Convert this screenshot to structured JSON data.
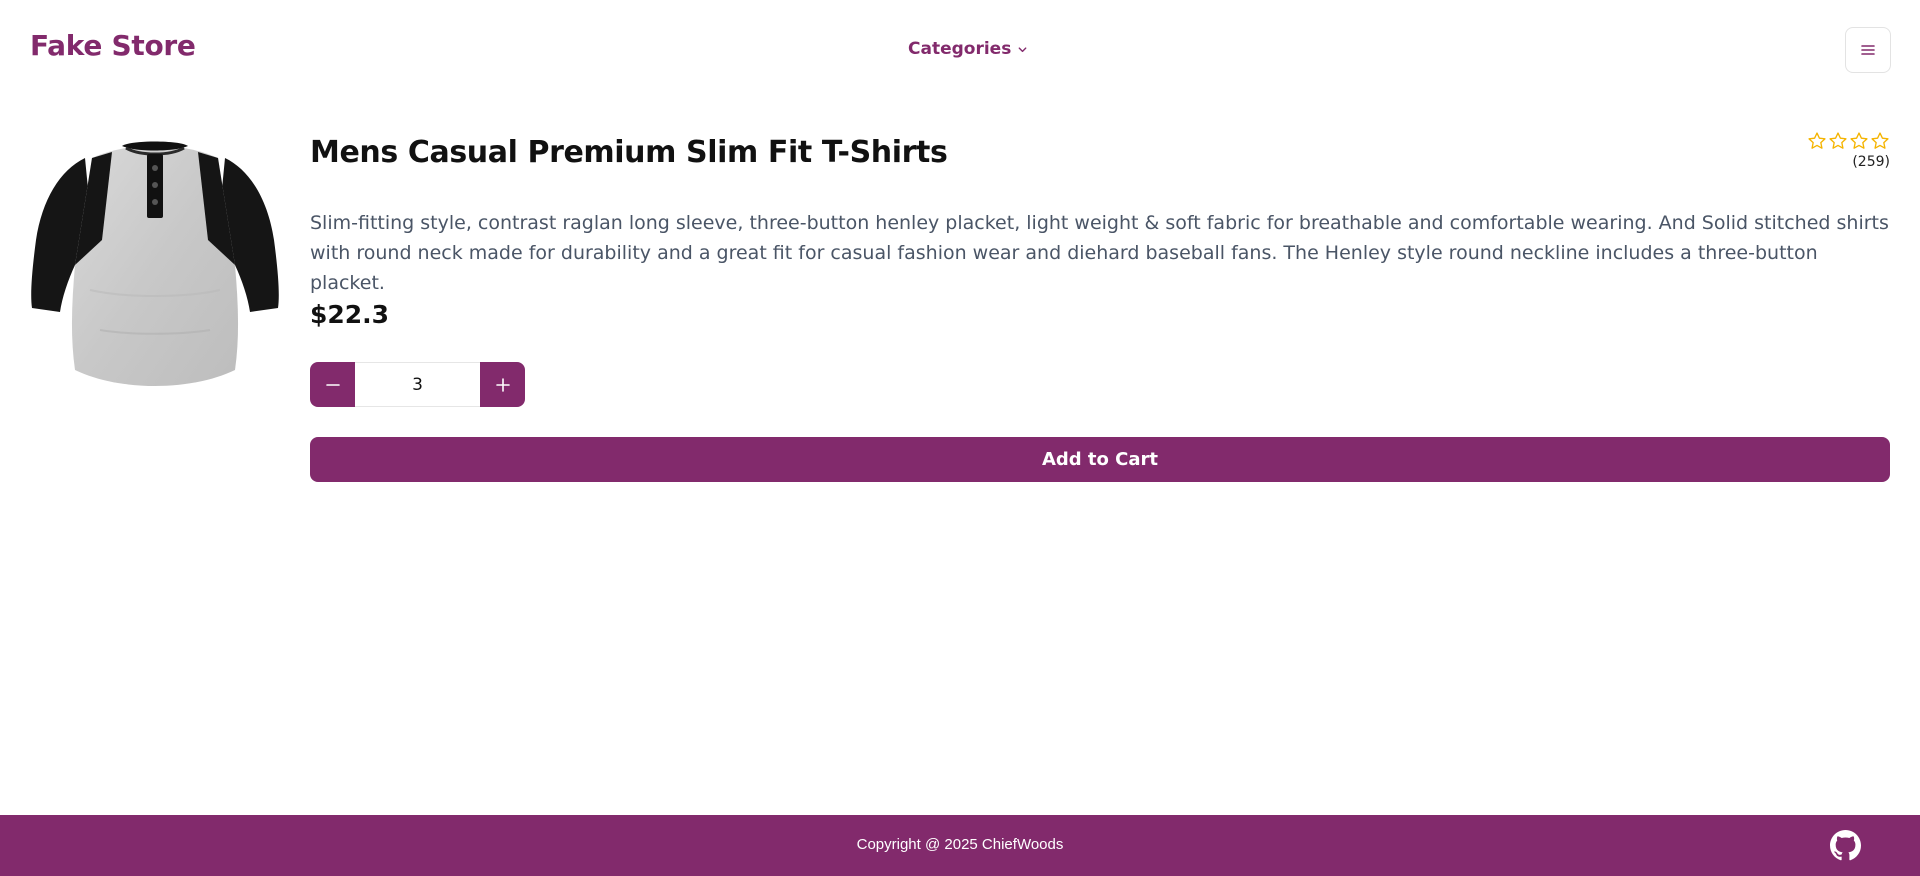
{
  "header": {
    "brand": "Fake Store",
    "categories_label": "Categories",
    "categories_icon": "chevron-down-icon",
    "menu_icon": "hamburger-menu-icon"
  },
  "product": {
    "image_icon": "t-shirt-product-image",
    "title": "Mens Casual Premium Slim Fit T-Shirts",
    "rating": {
      "stars_filled": 0,
      "stars_total": 4,
      "count": "(259)"
    },
    "description": "Slim-fitting style, contrast raglan long sleeve, three-button henley placket, light weight & soft fabric for breathable and comfortable wearing. And Solid stitched shirts with round neck made for durability and a great fit for casual fashion wear and diehard baseball fans. The Henley style round neckline includes a three-button placket.",
    "price": "$22.3",
    "quantity": "3",
    "add_to_cart_label": "Add to Cart"
  },
  "footer": {
    "copyright": "Copyright @ 2025 ChiefWoods",
    "github_icon": "github-icon"
  },
  "colors": {
    "primary": "#822a6c",
    "star": "#f5b400",
    "description_text": "#4a5566",
    "background": "#ffffff"
  }
}
